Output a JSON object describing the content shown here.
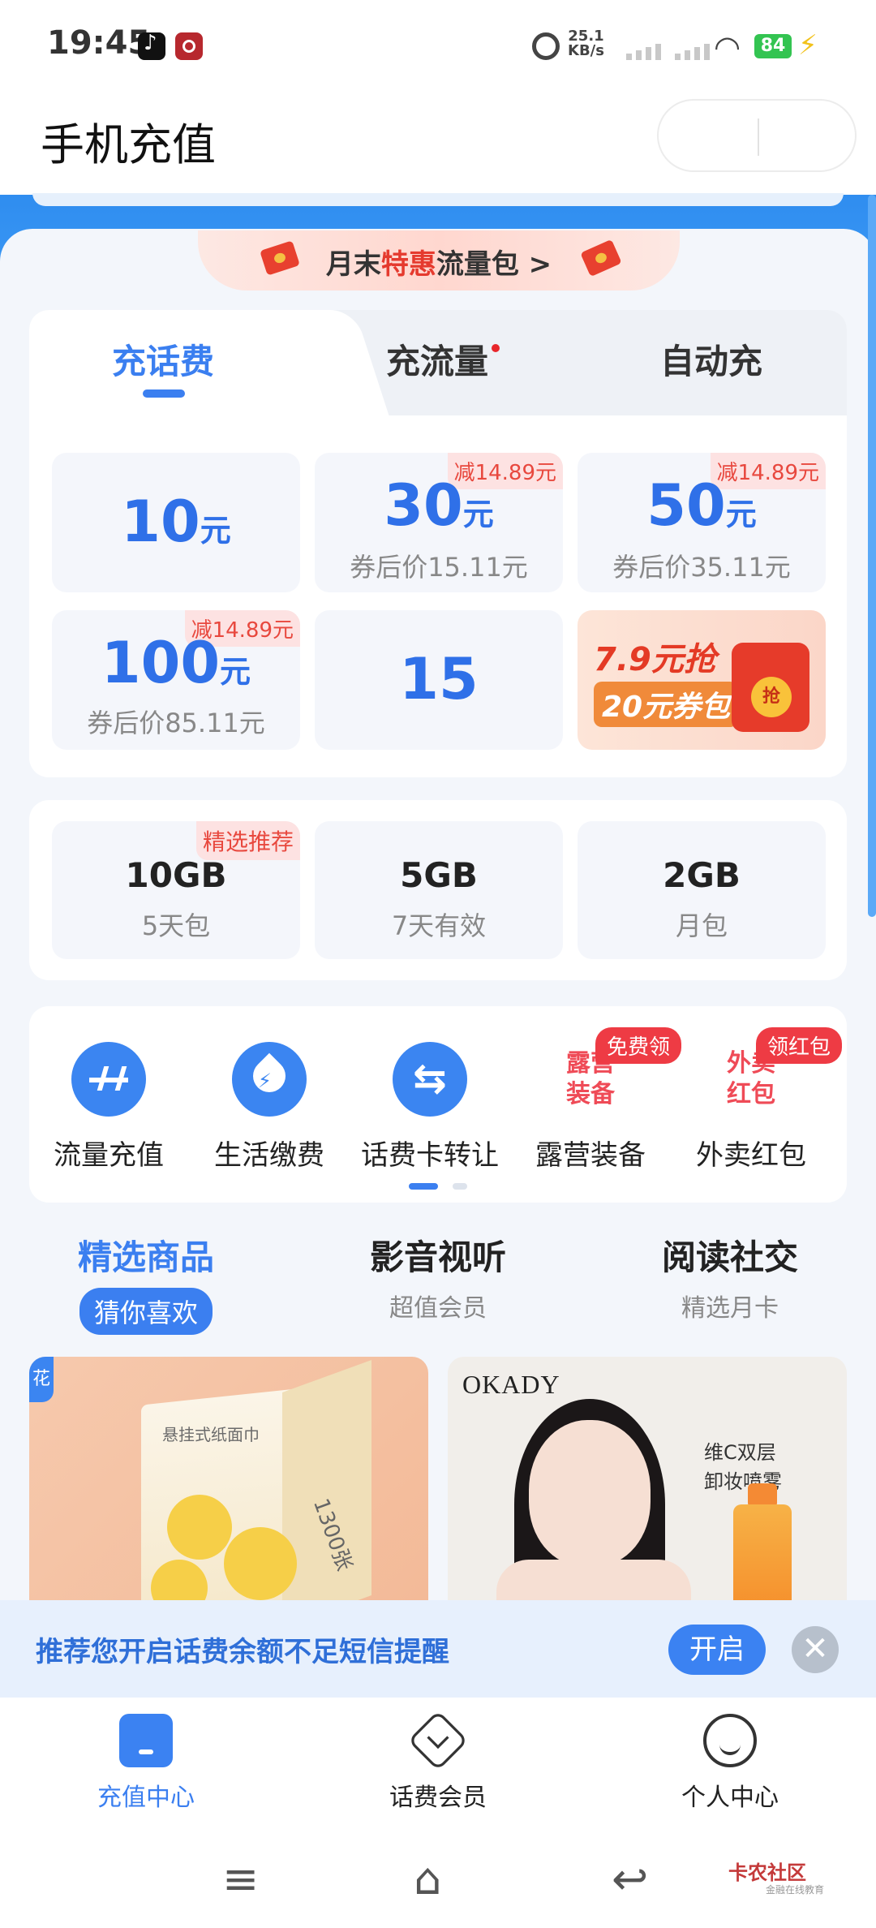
{
  "status_bar": {
    "time": "19:45",
    "net_speed_value": "25.1",
    "net_speed_unit": "KB/s",
    "battery": "84",
    "icons": [
      "tiktok-icon",
      "app-icon",
      "alarm-icon",
      "signal-icon",
      "wifi-icon",
      "battery-icon",
      "charging-icon"
    ]
  },
  "header": {
    "title": "手机充值"
  },
  "promo": {
    "prefix": "月末",
    "highlight": "特惠",
    "suffix": "流量包",
    "arrow": ">"
  },
  "recharge": {
    "tabs": [
      {
        "label": "充话费"
      },
      {
        "label": "充流量"
      },
      {
        "label": "自动充"
      }
    ],
    "tiles": [
      {
        "amount": "10",
        "unit": "元",
        "sub": "",
        "tag": ""
      },
      {
        "amount": "30",
        "unit": "元",
        "sub": "券后价15.11元",
        "tag": "减14.89元"
      },
      {
        "amount": "50",
        "unit": "元",
        "sub": "券后价35.11元",
        "tag": "减14.89元"
      },
      {
        "amount": "100",
        "unit": "元",
        "sub": "券后价85.11元",
        "tag": "减14.89元"
      },
      {
        "amount": "15",
        "unit": "",
        "sub": "",
        "tag": ""
      }
    ],
    "promo_tile": {
      "line1": "7.9元抢",
      "line2": "20元券包",
      "button": "抢"
    }
  },
  "data_plans": [
    {
      "size": "10GB",
      "duration": "5天包",
      "tag": "精选推荐"
    },
    {
      "size": "5GB",
      "duration": "7天有效",
      "tag": ""
    },
    {
      "size": "2GB",
      "duration": "月包",
      "tag": ""
    }
  ],
  "services": [
    {
      "label": "流量充值",
      "icon": "pulse-icon",
      "badge": ""
    },
    {
      "label": "生活缴费",
      "icon": "drop-bolt-icon",
      "badge": ""
    },
    {
      "label": "话费卡转让",
      "icon": "swap-icon",
      "badge": ""
    },
    {
      "label": "露营装备",
      "icon": "camping-art-icon",
      "art": "露营\n装备",
      "badge": "免费领"
    },
    {
      "label": "外卖红包",
      "icon": "takeout-art-icon",
      "art": "外卖\n红包",
      "badge": "领红包"
    }
  ],
  "categories": [
    {
      "title": "精选商品",
      "sub": "猜你喜欢"
    },
    {
      "title": "影音视听",
      "sub": "超值会员"
    },
    {
      "title": "阅读社交",
      "sub": "精选月卡"
    }
  ],
  "products": [
    {
      "corner": "花",
      "box_text": "悬挂式纸面巾",
      "count": "1300张"
    },
    {
      "brand": "OKADY",
      "quote_line1": "维C双层",
      "quote_line2": "卸妆喷雾"
    }
  ],
  "reminder": {
    "text": "推荐您开启话费余额不足短信提醒",
    "button": "开启",
    "close": "✕"
  },
  "bottom_nav": [
    {
      "label": "充值中心"
    },
    {
      "label": "话费会员"
    },
    {
      "label": "个人中心"
    }
  ],
  "system_nav": {
    "menu": "≡",
    "home": "⌂",
    "back": "↩"
  },
  "watermark": {
    "text": "卡农社区",
    "sub": "金融在线教育"
  },
  "colors": {
    "accent": "#3b7ff0",
    "price_blue": "#2f70e8",
    "tag_red": "#e8483e",
    "band_blue": "#2f8df0"
  }
}
